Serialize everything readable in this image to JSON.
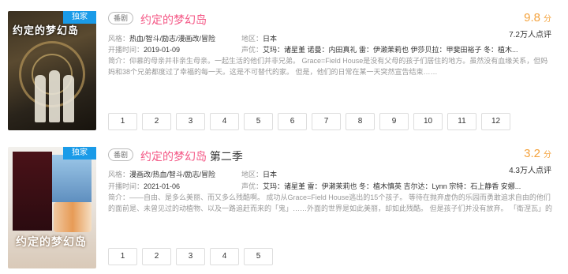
{
  "cards": [
    {
      "poster_text": "约定的梦幻岛",
      "badge": "独家",
      "tag": "番剧",
      "title": "约定的梦幻岛",
      "title_suffix": "",
      "score": "9.8",
      "score_unit": "分",
      "votes": "7.2万人点评",
      "genre_label": "风格：",
      "genre": "热血/智斗/励志/漫画改/冒险",
      "region_label": "地区：",
      "region": "日本",
      "date_label": "开播时间：",
      "date": "2019-01-09",
      "voice_label": "声优：",
      "voice": "艾玛：诸星堇 诺曼：内田真礼 雷：伊濑茉莉也 伊莎贝拉：甲斐田裕子 冬：植木...",
      "intro_label": "简介：",
      "intro": "仰慕的母亲并非亲生母亲。一起生活的他们并非兄弟。 Grace=Field House是没有父母的孩子们居住的地方。虽然没有血缘关系，但妈妈和38个兄弟都度过了幸福的每一天。这是不可替代的家。 但是，他们的日常在某一天突然宣告结束……",
      "episodes": [
        "1",
        "2",
        "3",
        "4",
        "5",
        "6",
        "7",
        "8",
        "9",
        "10",
        "11",
        "12"
      ]
    },
    {
      "poster_text": "约定的梦幻岛",
      "badge": "独家",
      "tag": "番剧",
      "title": "约定的梦幻岛",
      "title_suffix": " 第二季",
      "score": "3.2",
      "score_unit": "分",
      "votes": "4.3万人点评",
      "genre_label": "风格：",
      "genre": "漫画改/热血/智斗/励志/冒险",
      "region_label": "地区：",
      "region": "日本",
      "date_label": "开播时间：",
      "date": "2021-01-06",
      "voice_label": "声优：",
      "voice": "艾玛：诸星堇 雷：伊濑茉莉也 冬：植木慎英 吉尔达：Lynn 宗特：石上静香 安娜...",
      "intro_label": "简介：",
      "intro": "——自由、是多么美丽、而又多么残酷啊。 成功从Grace=Field House逃出的15个孩子。 等待在抛弃虚伪的乐园而勇敢追求自由的他们的面前是、未曾见过的动植物、以及一路追赶而来的「鬼」……外面的世界是如此美丽，却如此残酷。 但是孩子们并没有放弃。 「衛涅瓦」的讯息、谐...",
      "episodes": [
        "1",
        "2",
        "3",
        "4",
        "5"
      ]
    }
  ]
}
